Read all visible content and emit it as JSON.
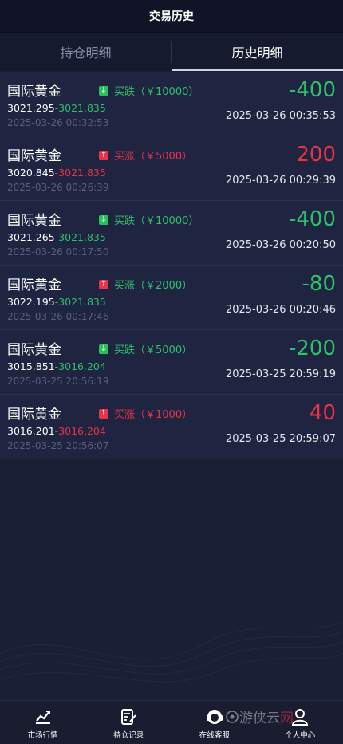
{
  "header": {
    "title": "交易历史"
  },
  "tabs": [
    {
      "label": "持仓明细",
      "active": false
    },
    {
      "label": "历史明细",
      "active": true
    }
  ],
  "trades": [
    {
      "name": "国际黄金",
      "direction": "down",
      "badge": "买跌（￥10000）",
      "open_price": "3021.295",
      "close_price": "3021.835",
      "close_color": "green",
      "open_time": "2025-03-26 00:32:53",
      "pnl": "-400",
      "pnl_color": "green",
      "close_time": "2025-03-26 00:35:53"
    },
    {
      "name": "国际黄金",
      "direction": "up",
      "badge": "买涨（￥5000）",
      "open_price": "3020.845",
      "close_price": "3021.835",
      "close_color": "red",
      "open_time": "2025-03-26 00:26:39",
      "pnl": "200",
      "pnl_color": "red",
      "close_time": "2025-03-26 00:29:39"
    },
    {
      "name": "国际黄金",
      "direction": "down",
      "badge": "买跌（￥10000）",
      "open_price": "3021.265",
      "close_price": "3021.835",
      "close_color": "green",
      "open_time": "2025-03-26 00:17:50",
      "pnl": "-400",
      "pnl_color": "green",
      "close_time": "2025-03-26 00:20:50"
    },
    {
      "name": "国际黄金",
      "direction": "up",
      "badge": "买涨（￥2000）",
      "open_price": "3022.195",
      "close_price": "3021.835",
      "close_color": "green",
      "open_time": "2025-03-26 00:17:46",
      "pnl": "-80",
      "pnl_color": "green",
      "close_time": "2025-03-26 00:20:46"
    },
    {
      "name": "国际黄金",
      "direction": "down",
      "badge": "买跌（￥5000）",
      "open_price": "3015.851",
      "close_price": "3016.204",
      "close_color": "green",
      "open_time": "2025-03-25 20:56:19",
      "pnl": "-200",
      "pnl_color": "green",
      "close_time": "2025-03-25 20:59:19"
    },
    {
      "name": "国际黄金",
      "direction": "up",
      "badge": "买涨（￥1000）",
      "open_price": "3016.201",
      "close_price": "3016.204",
      "close_color": "red",
      "open_time": "2025-03-25 20:56:07",
      "pnl": "40",
      "pnl_color": "red",
      "close_time": "2025-03-25 20:59:07"
    }
  ],
  "nav": [
    {
      "label": "市场行情",
      "icon": "chart-icon"
    },
    {
      "label": "持仓记录",
      "icon": "document-edit-icon"
    },
    {
      "label": "在线客服",
      "icon": "headset-icon"
    },
    {
      "label": "个人中心",
      "icon": "user-icon"
    }
  ],
  "watermark": {
    "text": "游侠云",
    "suffix": "网"
  },
  "colors": {
    "green": "#2ec26a",
    "red": "#e8334a",
    "background": "#1b1f36",
    "header": "#111426"
  }
}
